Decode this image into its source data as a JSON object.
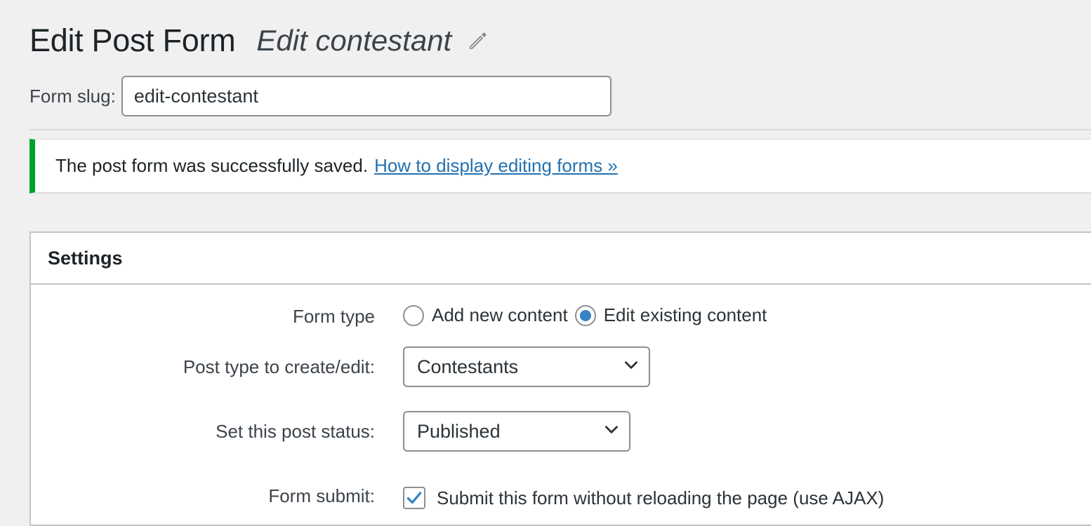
{
  "header": {
    "title": "Edit Post Form",
    "form_name": "Edit contestant",
    "edit_icon": "pencil-icon"
  },
  "slug": {
    "label": "Form slug:",
    "value": "edit-contestant"
  },
  "notice": {
    "message": "The post form was successfully saved.",
    "link_text": "How to display editing forms »",
    "accent_color": "#00a32a"
  },
  "settings": {
    "title": "Settings",
    "form_type": {
      "label": "Form type",
      "options": [
        {
          "label": "Add new content",
          "selected": false
        },
        {
          "label": "Edit existing content",
          "selected": true
        }
      ]
    },
    "post_type": {
      "label": "Post type to create/edit:",
      "selected": "Contestants"
    },
    "post_status": {
      "label": "Set this post status:",
      "selected": "Published"
    },
    "form_submit": {
      "label": "Form submit:",
      "checkbox_label": "Submit this form without reloading the page (use AJAX)",
      "checked": true
    }
  }
}
